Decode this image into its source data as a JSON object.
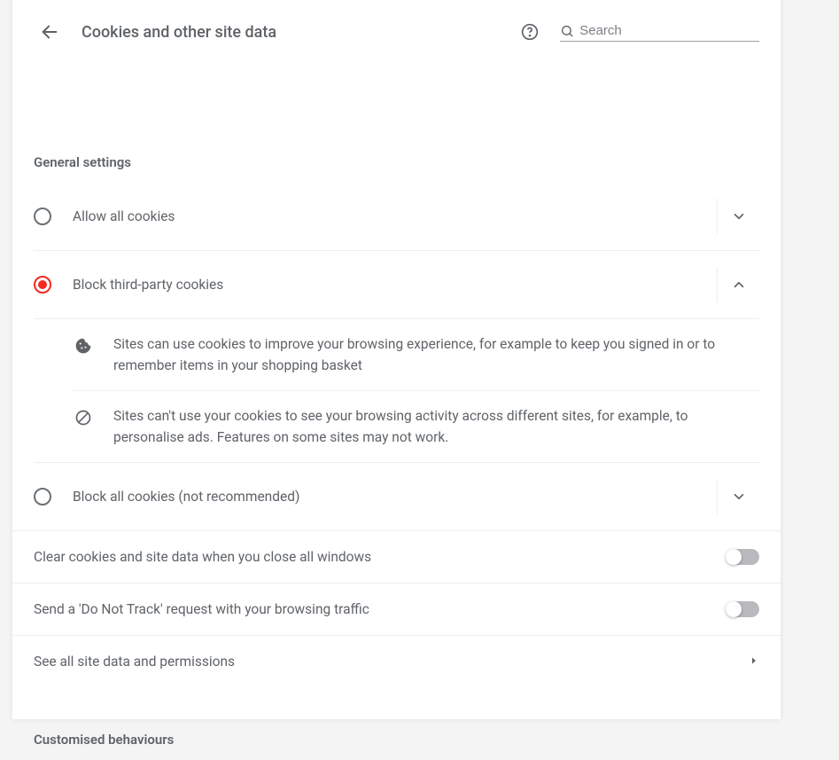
{
  "header": {
    "title": "Cookies and other site data",
    "search_placeholder": "Search"
  },
  "sections": {
    "general": "General settings",
    "custom": "Customised behaviours"
  },
  "options": {
    "allow_all": "Allow all cookies",
    "block_third": "Block third-party cookies",
    "block_all": "Block all cookies (not recommended)"
  },
  "details": {
    "d1": "Sites can use cookies to improve your browsing experience, for example to keep you signed in or to remember items in your shopping basket",
    "d2": "Sites can't use your cookies to see your browsing activity across different sites, for example, to personalise ads. Features on some sites may not work."
  },
  "rows": {
    "clear_on_close": "Clear cookies and site data when you close all windows",
    "do_not_track": "Send a 'Do Not Track' request with your browsing traffic",
    "see_all": "See all site data and permissions"
  }
}
